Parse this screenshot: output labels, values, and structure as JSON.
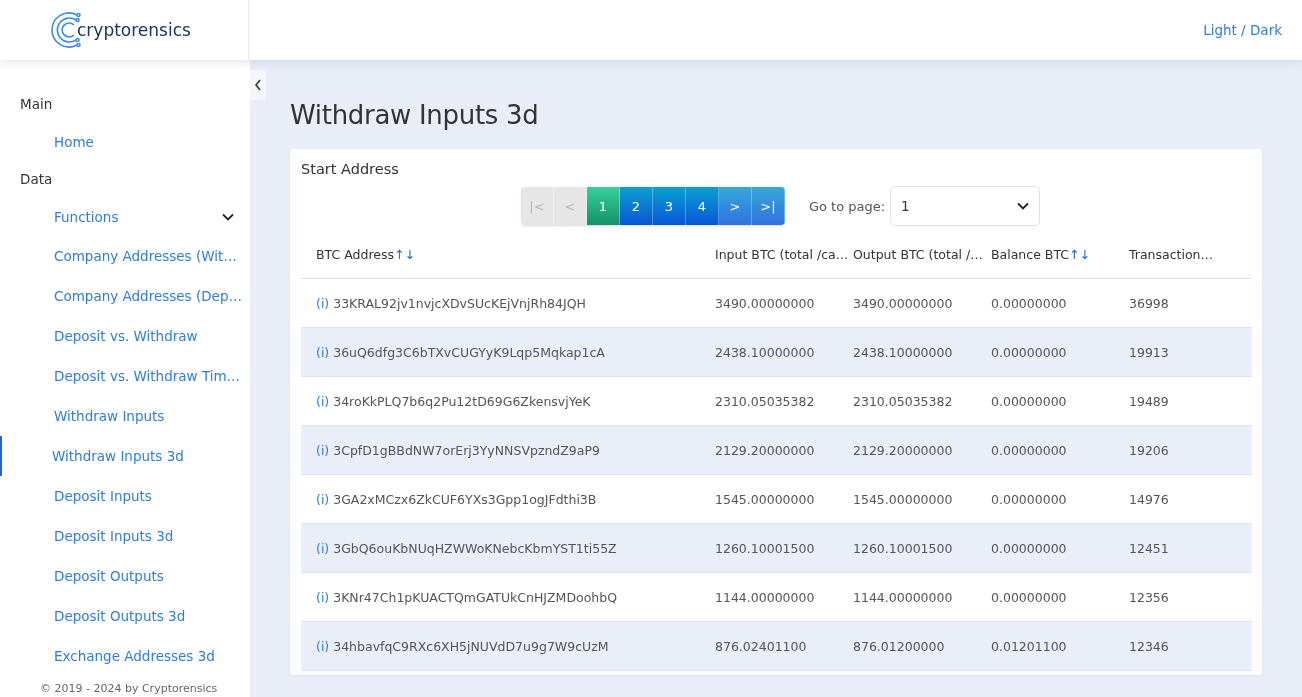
{
  "header": {
    "logo_text": "cryptorensics",
    "theme_toggle": "Light / Dark"
  },
  "sidebar": {
    "sections": [
      {
        "title": "Main",
        "items": [
          {
            "label": "Home",
            "selected": false
          }
        ]
      },
      {
        "title": "Data",
        "items": [
          {
            "label": "Functions",
            "selected": false,
            "expanded": true
          },
          {
            "label": "Company Addresses (Wit…",
            "selected": false
          },
          {
            "label": "Company Addresses (Dep…",
            "selected": false
          },
          {
            "label": "Deposit vs. Withdraw",
            "selected": false
          },
          {
            "label": "Deposit vs. Withdraw Tim…",
            "selected": false
          },
          {
            "label": "Withdraw Inputs",
            "selected": false
          },
          {
            "label": "Withdraw Inputs 3d",
            "selected": true
          },
          {
            "label": "Deposit Inputs",
            "selected": false
          },
          {
            "label": "Deposit Inputs 3d",
            "selected": false
          },
          {
            "label": "Deposit Outputs",
            "selected": false
          },
          {
            "label": "Deposit Outputs 3d",
            "selected": false
          },
          {
            "label": "Exchange Addresses 3d",
            "selected": false
          }
        ]
      }
    ],
    "footer": "© 2019 - 2024 by Cryptorensics"
  },
  "page": {
    "title": "Withdraw Inputs 3d"
  },
  "card": {
    "title": "Start Address",
    "pagination": [
      {
        "kind": "nav",
        "label": "|<",
        "disabled": true,
        "selected": false
      },
      {
        "kind": "nav",
        "label": "<",
        "disabled": true,
        "selected": false
      },
      {
        "kind": "page",
        "label": "1",
        "disabled": false,
        "selected": true
      },
      {
        "kind": "page",
        "label": "2",
        "disabled": false,
        "selected": false
      },
      {
        "kind": "page",
        "label": "3",
        "disabled": false,
        "selected": false
      },
      {
        "kind": "page",
        "label": "4",
        "disabled": false,
        "selected": false
      },
      {
        "kind": "nav",
        "label": ">",
        "disabled": false,
        "selected": false
      },
      {
        "kind": "nav",
        "label": ">|",
        "disabled": false,
        "selected": false
      }
    ],
    "goto_label": "Go to page:",
    "goto_value": "1",
    "table": {
      "columns": [
        {
          "label": "BTC Address",
          "sort": "↑↓"
        },
        {
          "label": "Input BTC (total /ca…"
        },
        {
          "label": "Output BTC (total /…"
        },
        {
          "label": "Balance BTC",
          "sort": "↑↓"
        },
        {
          "label": "Transaction…"
        }
      ],
      "rows": [
        {
          "info": "(i)",
          "address": "33KRAL92jv1nvjcXDvSUcKEjVnjRh84JQH",
          "input": "3490.00000000",
          "output": "3490.00000000",
          "balance": "0.00000000",
          "transactions": "36998"
        },
        {
          "info": "(i)",
          "address": "36uQ6dfg3C6bTXvCUGYyK9Lqp5Mqkap1cA",
          "input": "2438.10000000",
          "output": "2438.10000000",
          "balance": "0.00000000",
          "transactions": "19913"
        },
        {
          "info": "(i)",
          "address": "34roKkPLQ7b6q2Pu12tD69G6ZkensvjYeK",
          "input": "2310.05035382",
          "output": "2310.05035382",
          "balance": "0.00000000",
          "transactions": "19489"
        },
        {
          "info": "(i)",
          "address": "3CpfD1gBBdNW7orErj3YyNNSVpzndZ9aP9",
          "input": "2129.20000000",
          "output": "2129.20000000",
          "balance": "0.00000000",
          "transactions": "19206"
        },
        {
          "info": "(i)",
          "address": "3GA2xMCzx6ZkCUF6YXs3Gpp1ogJFdthi3B",
          "input": "1545.00000000",
          "output": "1545.00000000",
          "balance": "0.00000000",
          "transactions": "14976"
        },
        {
          "info": "(i)",
          "address": "3GbQ6ouKbNUqHZWWoKNebcKbmYST1ti55Z",
          "input": "1260.10001500",
          "output": "1260.10001500",
          "balance": "0.00000000",
          "transactions": "12451"
        },
        {
          "info": "(i)",
          "address": "3KNr47Ch1pKUACTQmGATUkCnHJZMDoohbQ",
          "input": "1144.00000000",
          "output": "1144.00000000",
          "balance": "0.00000000",
          "transactions": "12356"
        },
        {
          "info": "(i)",
          "address": "34hbavfqC9RXc6XH5jNUVdD7u9g7W9cUzM",
          "input": "876.02401100",
          "output": "876.01200000",
          "balance": "0.01201100",
          "transactions": "12346"
        }
      ]
    }
  }
}
